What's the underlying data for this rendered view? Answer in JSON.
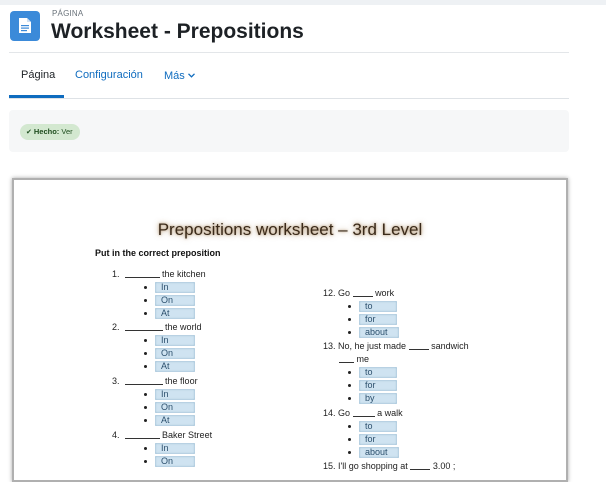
{
  "header": {
    "kicker": "PÁGINA",
    "title": "Worksheet - Prepositions"
  },
  "nav": {
    "tabs": [
      {
        "label": "Página",
        "active": true
      },
      {
        "label": "Configuración",
        "active": false
      },
      {
        "label": "Más",
        "active": false,
        "dropdown": true
      }
    ]
  },
  "completion": {
    "label": "Hecho:",
    "value": "Ver"
  },
  "worksheet": {
    "title": "Prepositions worksheet – 3rd Level",
    "instruction": "Put in the correct preposition",
    "questions_left": [
      {
        "num": "1.",
        "text": "the kitchen",
        "options": [
          "In",
          "On",
          "At"
        ]
      },
      {
        "num": "2.",
        "text": "the world",
        "options": [
          "In",
          "On",
          "At"
        ]
      },
      {
        "num": "3.",
        "text": "the floor",
        "options": [
          "In",
          "On",
          "At"
        ]
      },
      {
        "num": "4.",
        "text": "Baker Street",
        "options": [
          "In",
          "On"
        ]
      }
    ],
    "questions_right": [
      {
        "prefix": "12. Go",
        "suffix": "work",
        "options": [
          "to",
          "for",
          "about"
        ]
      },
      {
        "prefix": "13. No, he just made",
        "suffix": "sandwich",
        "line2": "me",
        "options": [
          "to",
          "for",
          "by"
        ]
      },
      {
        "prefix": "14. Go",
        "suffix": "a walk",
        "options": [
          "to",
          "for",
          "about"
        ]
      },
      {
        "prefix": "15. I'll go shopping at",
        "suffix": "3.00 ;"
      }
    ]
  },
  "colors": {
    "accent": "#0f6cbf",
    "icon_bg": "#3b8ad9",
    "badge_bg": "#d3e8d0",
    "option_bg": "#cfe3f1"
  }
}
